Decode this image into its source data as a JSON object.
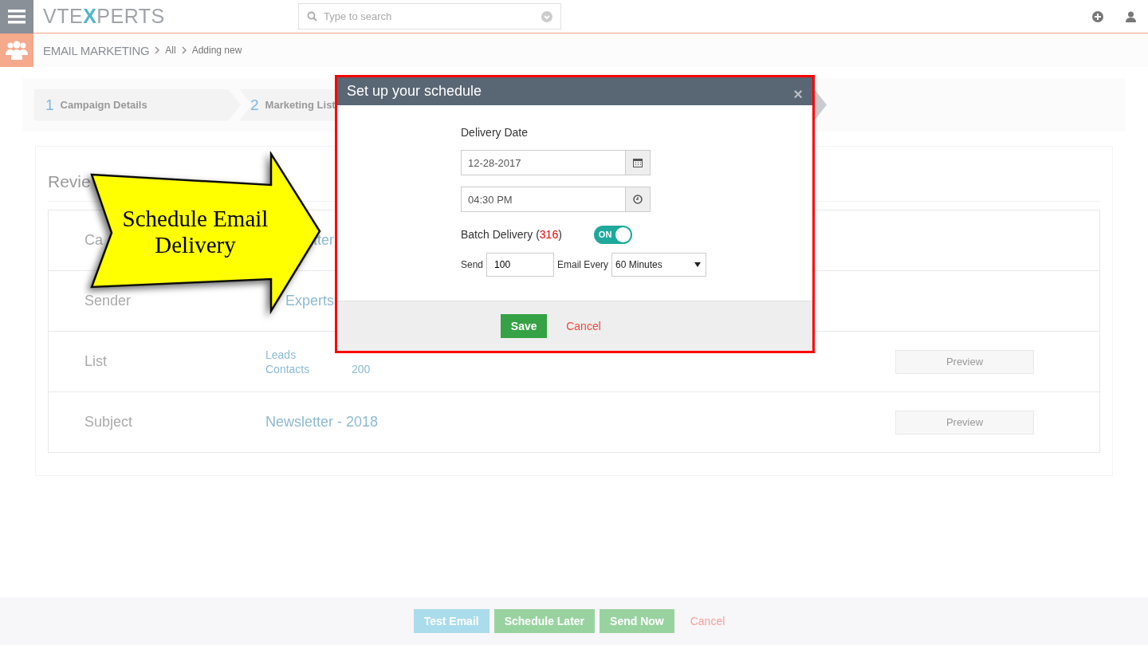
{
  "topbar": {
    "logo": [
      "VTE",
      "X",
      "PERTS"
    ],
    "search": {
      "placeholder": "Type to search"
    }
  },
  "breadcrumb": {
    "module": "EMAIL MARKETING",
    "items": [
      "All",
      "Adding new"
    ]
  },
  "steps": [
    {
      "number": "1",
      "label": "Campaign Details"
    },
    {
      "number": "2",
      "label": "Marketing List"
    }
  ],
  "review": {
    "title": "Revie",
    "rows": [
      {
        "kind": "cut",
        "label": "Ca",
        "values": [
          "tter"
        ]
      },
      {
        "kind": "cut",
        "label": "Sender",
        "values": [
          "Experts"
        ]
      },
      {
        "kind": "list",
        "label": "List",
        "values": [
          "Leads",
          "Contacts"
        ],
        "count": "200",
        "button": "Preview"
      },
      {
        "kind": "plain",
        "label": "Subject",
        "values": [
          "Newsletter - 2018"
        ],
        "button": "Preview"
      }
    ]
  },
  "callout": {
    "lines": [
      "Schedule Email",
      "Delivery"
    ]
  },
  "modal": {
    "title": "Set up your schedule",
    "close": "×",
    "date_label": "Delivery Date",
    "date": "12-28-2017",
    "time": "04:30 PM",
    "batch_label": "Batch Delivery (",
    "batch_count": "316",
    "batch_end": ")",
    "batch_on": true,
    "toggle_text": "ON",
    "send_label": "Send",
    "send_value": "100",
    "every_label": "Email Every",
    "every_value": "60 Minutes",
    "save": "Save",
    "cancel": "Cancel"
  },
  "footer": {
    "buttons": [
      {
        "kind": "info",
        "label": "Test Email"
      },
      {
        "kind": "success",
        "label": "Schedule Later"
      },
      {
        "kind": "success",
        "label": "Send Now"
      },
      {
        "kind": "link",
        "label": "Cancel"
      }
    ]
  }
}
